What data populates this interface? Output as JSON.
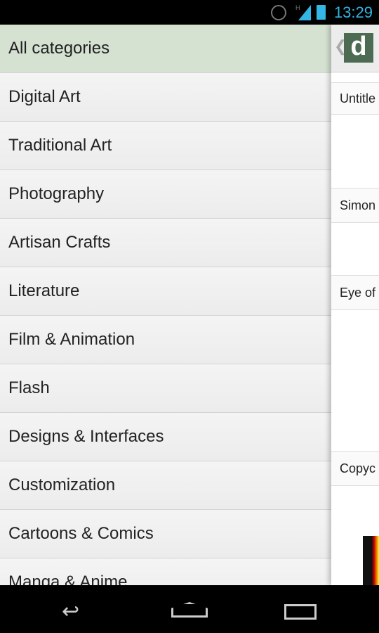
{
  "status": {
    "time": "13:29",
    "network": "H",
    "icons": [
      "alarm-icon",
      "signal-icon",
      "battery-icon"
    ]
  },
  "drawer": {
    "items": [
      {
        "label": "All categories",
        "selected": true
      },
      {
        "label": "Digital Art"
      },
      {
        "label": "Traditional Art"
      },
      {
        "label": "Photography"
      },
      {
        "label": "Artisan Crafts"
      },
      {
        "label": "Literature"
      },
      {
        "label": "Film & Animation"
      },
      {
        "label": "Flash"
      },
      {
        "label": "Designs & Interfaces"
      },
      {
        "label": "Customization"
      },
      {
        "label": "Cartoons & Comics"
      },
      {
        "label": "Manga & Anime"
      }
    ]
  },
  "panel": {
    "logo": "d",
    "items": [
      "Untitle",
      "Simon",
      "Eye of",
      "Copyc"
    ]
  },
  "colors": {
    "accent": "#33b5e5",
    "selected": "#d5e2d2"
  }
}
